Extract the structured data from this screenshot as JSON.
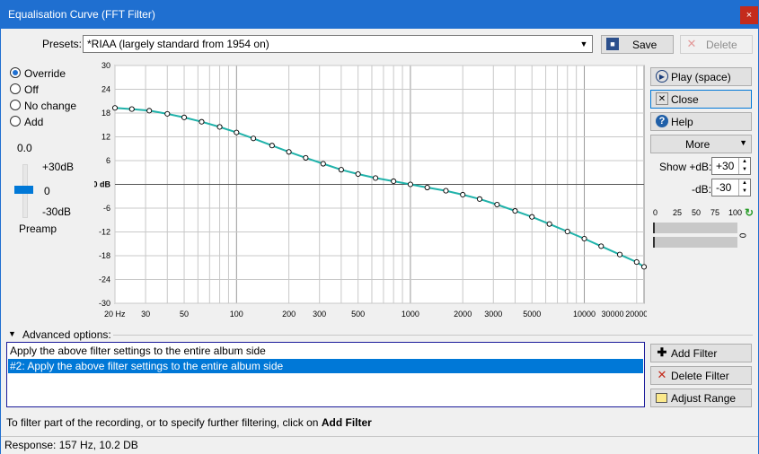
{
  "window": {
    "title": "Equalisation Curve (FFT Filter)",
    "close_glyph": "×"
  },
  "presets": {
    "label": "Presets:",
    "value": "*RIAA (largely standard from 1954 on)",
    "save": "Save",
    "delete": "Delete"
  },
  "mode": {
    "options": [
      "Override",
      "Off",
      "No change",
      "Add"
    ],
    "selected": "Override"
  },
  "preamp": {
    "value": "0.0",
    "max_label": "+30dB",
    "mid_label": "0",
    "min_label": "-30dB",
    "label": "Preamp",
    "level": 0
  },
  "actions": {
    "play": "Play (space)",
    "close": "Close",
    "help": "Help",
    "more": "More"
  },
  "display": {
    "show_plus_label": "Show +dB:",
    "plus_value": "+30",
    "minus_label": "-dB:",
    "minus_value": "-30"
  },
  "meter": {
    "scale": [
      "0",
      "25",
      "50",
      "75",
      "100"
    ],
    "side_value": "0"
  },
  "chart_data": {
    "type": "line",
    "xscale": "log",
    "xlim": [
      20,
      22050
    ],
    "ylim": [
      -30,
      30
    ],
    "x_ticks": [
      "20 Hz",
      "30",
      "50",
      "100",
      "200",
      "300",
      "500",
      "1000",
      "2000",
      "3000",
      "5000",
      "10000",
      "20000",
      "30000"
    ],
    "x_tick_values": [
      20,
      30,
      50,
      100,
      200,
      300,
      500,
      1000,
      2000,
      3000,
      5000,
      10000,
      20000,
      30000
    ],
    "y_ticks": [
      "30",
      "24",
      "18",
      "12",
      "6",
      "0 dB",
      "-6",
      "-12",
      "-18",
      "-24",
      "-30"
    ],
    "y_tick_values": [
      30,
      24,
      18,
      12,
      6,
      0,
      -6,
      -12,
      -18,
      -24,
      -30
    ],
    "grid": true,
    "series": [
      {
        "color": "#20b2aa",
        "x": [
          20,
          25,
          31.5,
          40,
          50,
          63,
          80,
          100,
          125,
          160,
          200,
          250,
          315,
          400,
          500,
          630,
          800,
          1000,
          1250,
          1600,
          2000,
          2500,
          3150,
          4000,
          5000,
          6300,
          8000,
          10000,
          12500,
          16000,
          20000,
          22050
        ],
        "y": [
          19.3,
          19.0,
          18.6,
          17.8,
          16.9,
          15.8,
          14.5,
          13.1,
          11.6,
          9.8,
          8.2,
          6.7,
          5.2,
          3.7,
          2.6,
          1.6,
          0.8,
          0.0,
          -0.8,
          -1.6,
          -2.6,
          -3.7,
          -5.1,
          -6.7,
          -8.2,
          -10.0,
          -11.9,
          -13.7,
          -15.6,
          -17.7,
          -19.6,
          -20.8
        ]
      }
    ]
  },
  "advanced": {
    "label": "Advanced options:",
    "filters": [
      "Apply the above filter settings to the entire album side",
      "#2: Apply the above filter settings to the entire album side"
    ],
    "selected_index": 1,
    "add_filter": "Add Filter",
    "delete_filter": "Delete Filter",
    "adjust_range": "Adjust Range"
  },
  "hint": {
    "text": "To filter part of the recording, or to specify further filtering, click on ",
    "bold": "Add Filter"
  },
  "status": {
    "text": "Response: 157 Hz, 10.2 DB"
  },
  "colors": {
    "accent": "#1f6fd0",
    "selection": "#0078d7",
    "curve": "#20b2aa"
  }
}
